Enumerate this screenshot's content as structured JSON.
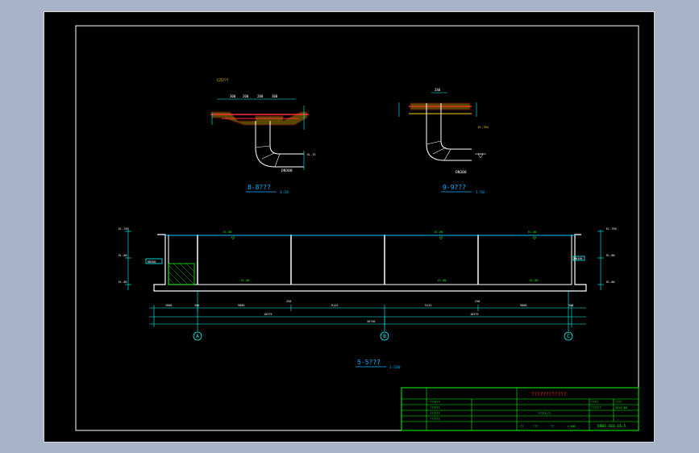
{
  "colors": {
    "background": "#a9b3c7",
    "sheet": "#000000",
    "frame": "#ffffff",
    "structure": "#ffffff",
    "water": "#00c8ff",
    "dim": "#00ffff",
    "hatch": "#00ff00",
    "title_block": "#00ff00",
    "lining": "#ff3030",
    "fill": "#ffd000",
    "title_text": "#00b4ff"
  },
  "section_8": {
    "label": "8-8???",
    "scale": "1:20",
    "note_top": "C25???",
    "dims": [
      "300",
      "200",
      "280",
      "300"
    ],
    "pipe_label": "DN300",
    "elev_right": "EL.75"
  },
  "section_9": {
    "label": "9-9???",
    "scale": "1:50",
    "dim_top": "280",
    "pipe_label": "DN300",
    "elev_right": "EL.750"
  },
  "section_5": {
    "label": "5-5???",
    "scale": "1:100",
    "left_elevs": [
      "EL.750",
      "EL.80",
      "EL.80"
    ],
    "right_elevs": [
      "EL.750",
      "EL.80",
      "EL.80"
    ],
    "inlet_label": "DN300",
    "outlet_label": "DN300",
    "water_elevs": [
      "EL.80",
      "EL.80",
      "EL.80"
    ],
    "bottom_elevs": [
      "EL.80",
      "EL.80",
      "EL.80"
    ],
    "spans_top": [
      "2800",
      "300",
      "9000",
      "250",
      "9125",
      "9125",
      "250",
      "9000",
      "300"
    ],
    "spans_mid": [
      "18375",
      "18375"
    ],
    "spans_total": "36750",
    "axes": [
      "A",
      "B",
      "C"
    ]
  },
  "title_block": {
    "project": "????????????",
    "rows_left": [
      "??????",
      "??????",
      "??????",
      "??????"
    ],
    "mid_label": "?????(?)",
    "right_cells": [
      "????",
      "??????",
      "????",
      "2014.08"
    ],
    "drawing_no": "09B1-301-16-5",
    "bottom_cells": [
      "??",
      "???",
      "??",
      "1:100"
    ]
  }
}
